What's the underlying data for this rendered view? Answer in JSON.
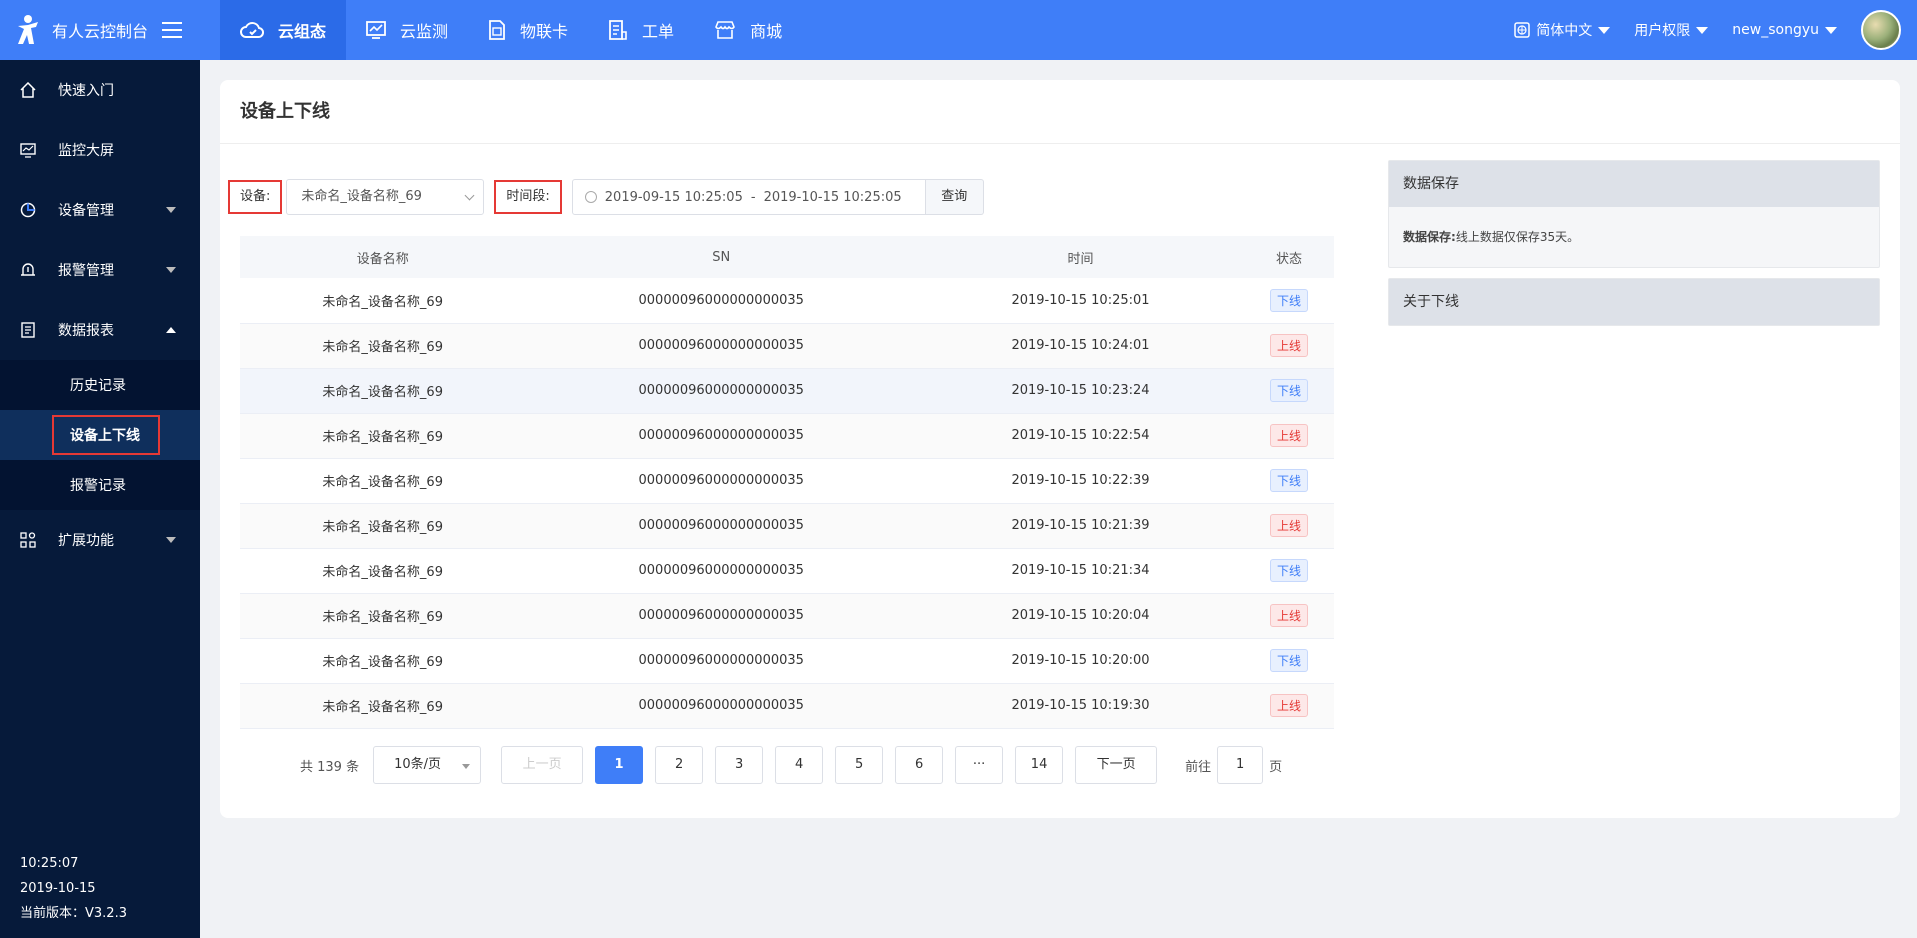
{
  "brand": {
    "name": "有人云控制台"
  },
  "topnav": [
    {
      "label": "云组态",
      "icon": "cloud-icon",
      "active": true
    },
    {
      "label": "云监测",
      "icon": "monitor-icon",
      "active": false
    },
    {
      "label": "物联卡",
      "icon": "sim-card-icon",
      "active": false
    },
    {
      "label": "工单",
      "icon": "ticket-icon",
      "active": false
    },
    {
      "label": "商城",
      "icon": "store-icon",
      "active": false
    }
  ],
  "topright": {
    "language": "简体中文",
    "permissions": "用户权限",
    "username": "new_songyu"
  },
  "sidebar": {
    "items": [
      {
        "label": "快速入门"
      },
      {
        "label": "监控大屏"
      },
      {
        "label": "设备管理"
      },
      {
        "label": "报警管理"
      },
      {
        "label": "数据报表"
      },
      {
        "label": "扩展功能"
      }
    ],
    "sub_items": [
      {
        "label": "历史记录"
      },
      {
        "label": "设备上下线"
      },
      {
        "label": "报警记录"
      }
    ],
    "footer": {
      "time": "10:25:07",
      "date": "2019-10-15",
      "version": "当前版本：V3.2.3"
    }
  },
  "page": {
    "title": "设备上下线"
  },
  "filters": {
    "device_label": "设备:",
    "device_value": "未命名_设备名称_69",
    "period_label": "时间段:",
    "start": "2019-09-15 10:25:05",
    "range_sep": "-",
    "end": "2019-10-15 10:25:05",
    "query_label": "查询"
  },
  "table": {
    "headers": [
      "设备名称",
      "SN",
      "时间",
      "状态"
    ],
    "rows": [
      {
        "name": "未命名_设备名称_69",
        "sn": "00000096000000000035",
        "time": "2019-10-15 10:25:01",
        "status": "下线"
      },
      {
        "name": "未命名_设备名称_69",
        "sn": "00000096000000000035",
        "time": "2019-10-15 10:24:01",
        "status": "上线"
      },
      {
        "name": "未命名_设备名称_69",
        "sn": "00000096000000000035",
        "time": "2019-10-15 10:23:24",
        "status": "下线"
      },
      {
        "name": "未命名_设备名称_69",
        "sn": "00000096000000000035",
        "time": "2019-10-15 10:22:54",
        "status": "上线"
      },
      {
        "name": "未命名_设备名称_69",
        "sn": "00000096000000000035",
        "time": "2019-10-15 10:22:39",
        "status": "下线"
      },
      {
        "name": "未命名_设备名称_69",
        "sn": "00000096000000000035",
        "time": "2019-10-15 10:21:39",
        "status": "上线"
      },
      {
        "name": "未命名_设备名称_69",
        "sn": "00000096000000000035",
        "time": "2019-10-15 10:21:34",
        "status": "下线"
      },
      {
        "name": "未命名_设备名称_69",
        "sn": "00000096000000000035",
        "time": "2019-10-15 10:20:04",
        "status": "上线"
      },
      {
        "name": "未命名_设备名称_69",
        "sn": "00000096000000000035",
        "time": "2019-10-15 10:20:00",
        "status": "下线"
      },
      {
        "name": "未命名_设备名称_69",
        "sn": "00000096000000000035",
        "time": "2019-10-15 10:19:30",
        "status": "上线"
      }
    ]
  },
  "pagination": {
    "total": "共 139 条",
    "page_size": "10条/页",
    "prev": "上一页",
    "pages": [
      "1",
      "2",
      "3",
      "4",
      "5",
      "6",
      "···",
      "14"
    ],
    "current": "1",
    "next": "下一页",
    "goto_label": "前往",
    "goto_value": "1",
    "goto_suffix": "页"
  },
  "right_panel": {
    "storage_title": "数据保存",
    "storage_label": "数据保存:",
    "storage_text": "线上数据仅保存35天。",
    "offline_title": "关于下线"
  },
  "colors": {
    "primary": "#3f7ef8",
    "sidebar": "#061a3a",
    "highlight": "#e53935"
  }
}
